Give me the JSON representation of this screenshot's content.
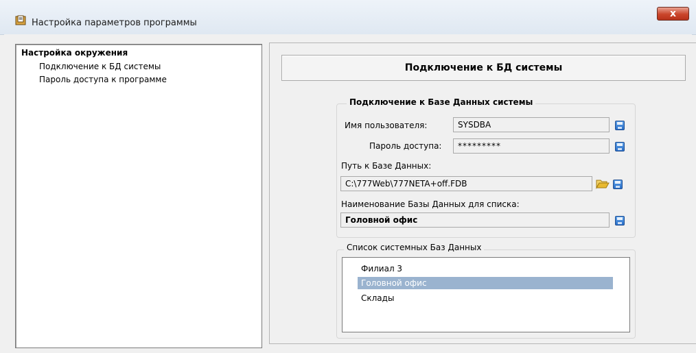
{
  "window": {
    "title": "Настройка параметров программы",
    "close_label": "x"
  },
  "tree": {
    "root": "Настройка окружения",
    "children": [
      "Подключение к БД системы",
      "Пароль доступа к программе"
    ]
  },
  "panel": {
    "header": "Подключение к БД системы",
    "db_group": {
      "legend": "Подключение к Базе Данных системы",
      "user_label": "Имя пользователя:",
      "user_value": "SYSDBA",
      "password_label": "Пароль доступа:",
      "password_value": "*********",
      "path_label": "Путь к Базе Данных:",
      "path_value": "C:\\777Web\\777NETA+off.FDB",
      "name_label": "Наименование Базы Данных для списка:",
      "name_value": "Головной офис"
    },
    "list_group": {
      "legend": "Список системных Баз Данных",
      "items": [
        "Филиал 3",
        "Головной офис",
        "Склады"
      ],
      "selected_index": 1
    }
  },
  "colors": {
    "selection": "#9ab3cf",
    "close_button": "#c9452a",
    "save_icon": "#2a6fc8",
    "folder_icon": "#e8b930"
  }
}
